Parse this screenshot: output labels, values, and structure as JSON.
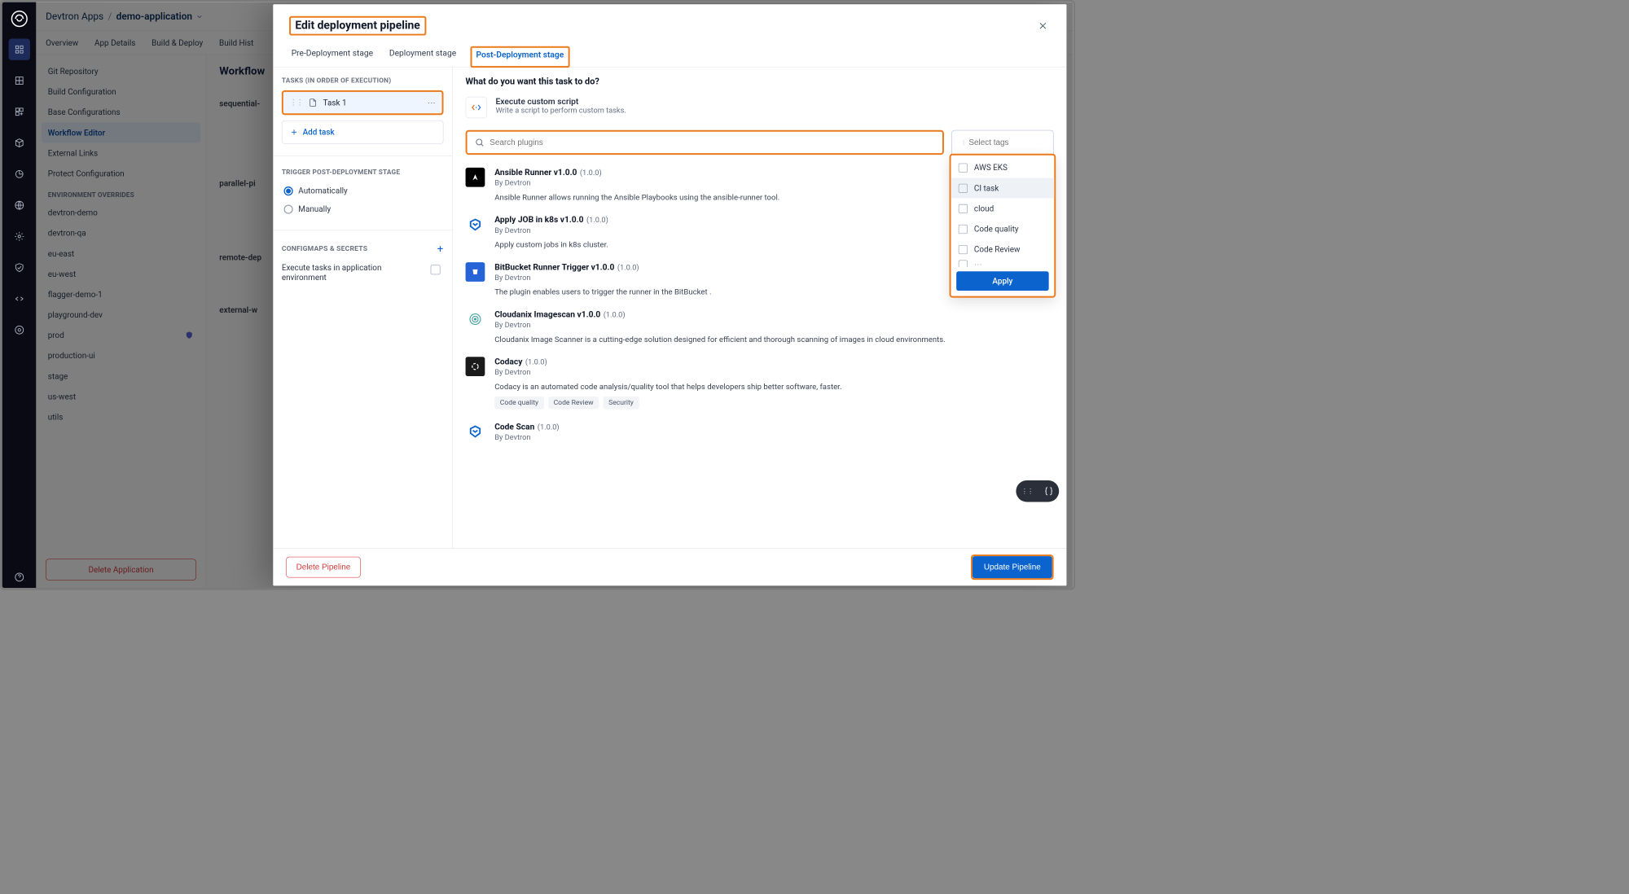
{
  "breadcrumb": {
    "root": "Devtron Apps",
    "sep": "/",
    "app": "demo-application"
  },
  "app_tabs": [
    "Overview",
    "App Details",
    "Build & Deploy",
    "Build Hist"
  ],
  "left_nav": {
    "top": [
      "Git Repository",
      "Build Configuration",
      "Base Configurations",
      "Workflow Editor",
      "External Links",
      "Protect Configuration"
    ],
    "top_selected": "Workflow Editor",
    "env_header": "ENVIRONMENT OVERRIDES",
    "envs": [
      "devtron-demo",
      "devtron-qa",
      "eu-east",
      "eu-west",
      "flagger-demo-1",
      "playground-dev",
      "prod",
      "production-ui",
      "stage",
      "us-west",
      "utils"
    ],
    "delete_app": "Delete Application"
  },
  "workflow": {
    "title": "Workflow",
    "rows": [
      "sequential-",
      "parallel-pi",
      "remote-dep",
      "external-w"
    ]
  },
  "modal": {
    "title": "Edit deployment pipeline",
    "tabs": {
      "pre": "Pre-Deployment stage",
      "dep": "Deployment stage",
      "post": "Post-Deployment stage"
    },
    "active_tab": "post",
    "left": {
      "tasks_header": "TASKS (IN ORDER OF EXECUTION)",
      "task1": "Task 1",
      "add_task": "Add task",
      "trigger_header": "TRIGGER POST-DEPLOYMENT STAGE",
      "opt_auto": "Automatically",
      "opt_manual": "Manually",
      "trigger_selected": "Automatically",
      "cm_header": "CONFIGMAPS & SECRETS",
      "exec_label": "Execute tasks in application environment"
    },
    "right": {
      "heading": "What do you want this task to do?",
      "script_title": "Execute custom script",
      "script_sub": "Write a script to perform custom tasks.",
      "search_placeholder": "Search plugins",
      "tags_placeholder": "Select tags",
      "tags": [
        "AWS EKS",
        "CI task",
        "cloud",
        "Code quality",
        "Code Review"
      ],
      "tags_hover_index": 1,
      "tags_apply": "Apply",
      "plugins": [
        {
          "icon": "ansible",
          "icon_bg": "#000",
          "icon_fg": "#fff",
          "name": "Ansible Runner v1.0.0",
          "ver": "(1.0.0)",
          "by": "By Devtron",
          "desc": "Ansible Runner allows running the Ansible Playbooks using the ansible-runner tool.",
          "tags": []
        },
        {
          "icon": "k8s",
          "icon_bg": "#fff",
          "icon_fg": "#0b63ce",
          "name": "Apply JOB in k8s v1.0.0",
          "ver": "(1.0.0)",
          "by": "By Devtron",
          "desc": "Apply custom jobs in k8s cluster.",
          "tags": []
        },
        {
          "icon": "bitbucket",
          "icon_bg": "#2563d6",
          "icon_fg": "#fff",
          "name": "BitBucket Runner Trigger v1.0.0",
          "ver": "(1.0.0)",
          "by": "By Devtron",
          "desc": "The plugin enables users to trigger the runner in the BitBucket .",
          "tags": []
        },
        {
          "icon": "cloudanix",
          "icon_bg": "#fff",
          "icon_fg": "#4aa3a3",
          "name": "Cloudanix Imagescan v1.0.0",
          "ver": "(1.0.0)",
          "by": "By Devtron",
          "desc": "Cloudanix Image Scanner is a cutting-edge solution designed for efficient and thorough scanning of images in cloud environments.",
          "tags": []
        },
        {
          "icon": "codacy",
          "icon_bg": "#1a1a1a",
          "icon_fg": "#fff",
          "name": "Codacy",
          "ver": "(1.0.0)",
          "by": "By Devtron",
          "desc": "Codacy is an automated code analysis/quality tool that helps developers ship better software, faster.",
          "tags": [
            "Code quality",
            "Code Review",
            "Security"
          ]
        },
        {
          "icon": "k8s",
          "icon_bg": "#fff",
          "icon_fg": "#0b63ce",
          "name": "Code Scan",
          "ver": "(1.0.0)",
          "by": "By Devtron",
          "desc": "",
          "tags": []
        }
      ]
    },
    "footer": {
      "delete": "Delete Pipeline",
      "update": "Update Pipeline"
    }
  }
}
